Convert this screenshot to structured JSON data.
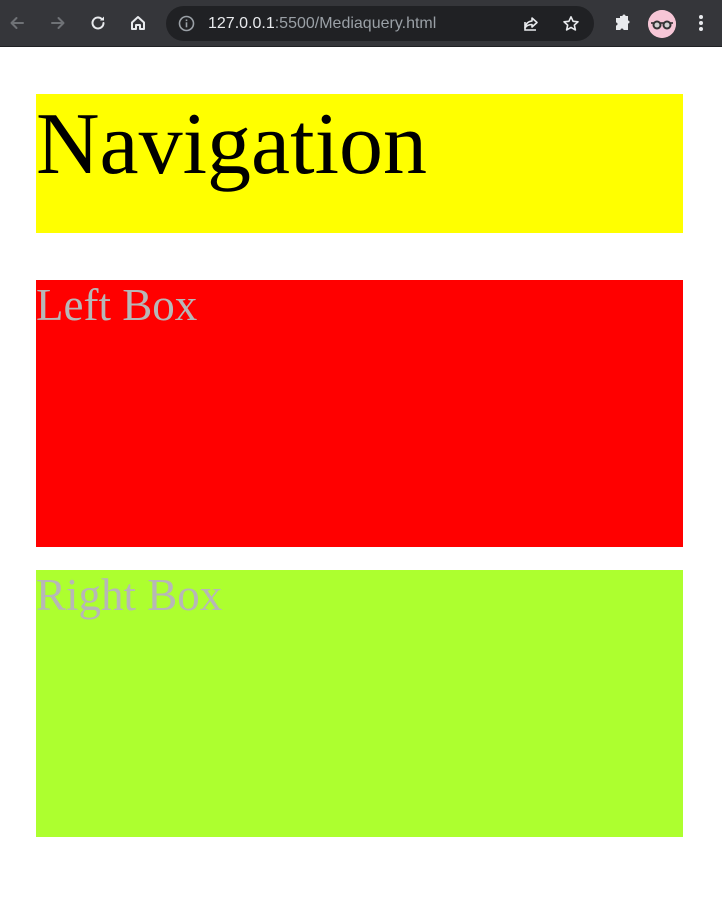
{
  "browser": {
    "url_host": "127.0.0.1",
    "url_rest": ":5500/Mediaquery.html",
    "icons": {
      "back": "arrow-left",
      "forward": "arrow-right",
      "reload": "reload",
      "home": "home",
      "site_info": "info-circle",
      "share": "share",
      "bookmark": "star",
      "extensions": "puzzle-piece",
      "profile": "avatar-sunglasses",
      "menu": "three-dots-vertical"
    }
  },
  "page": {
    "navigation": {
      "label": "Navigation",
      "background": "#ffff00",
      "text_color": "#000000"
    },
    "left_box": {
      "label": "Left Box",
      "background": "#ff0000",
      "text_color": "#b7b7b7"
    },
    "right_box": {
      "label": "Right Box",
      "background": "#adff2f",
      "text_color": "#b7b7b7"
    }
  }
}
